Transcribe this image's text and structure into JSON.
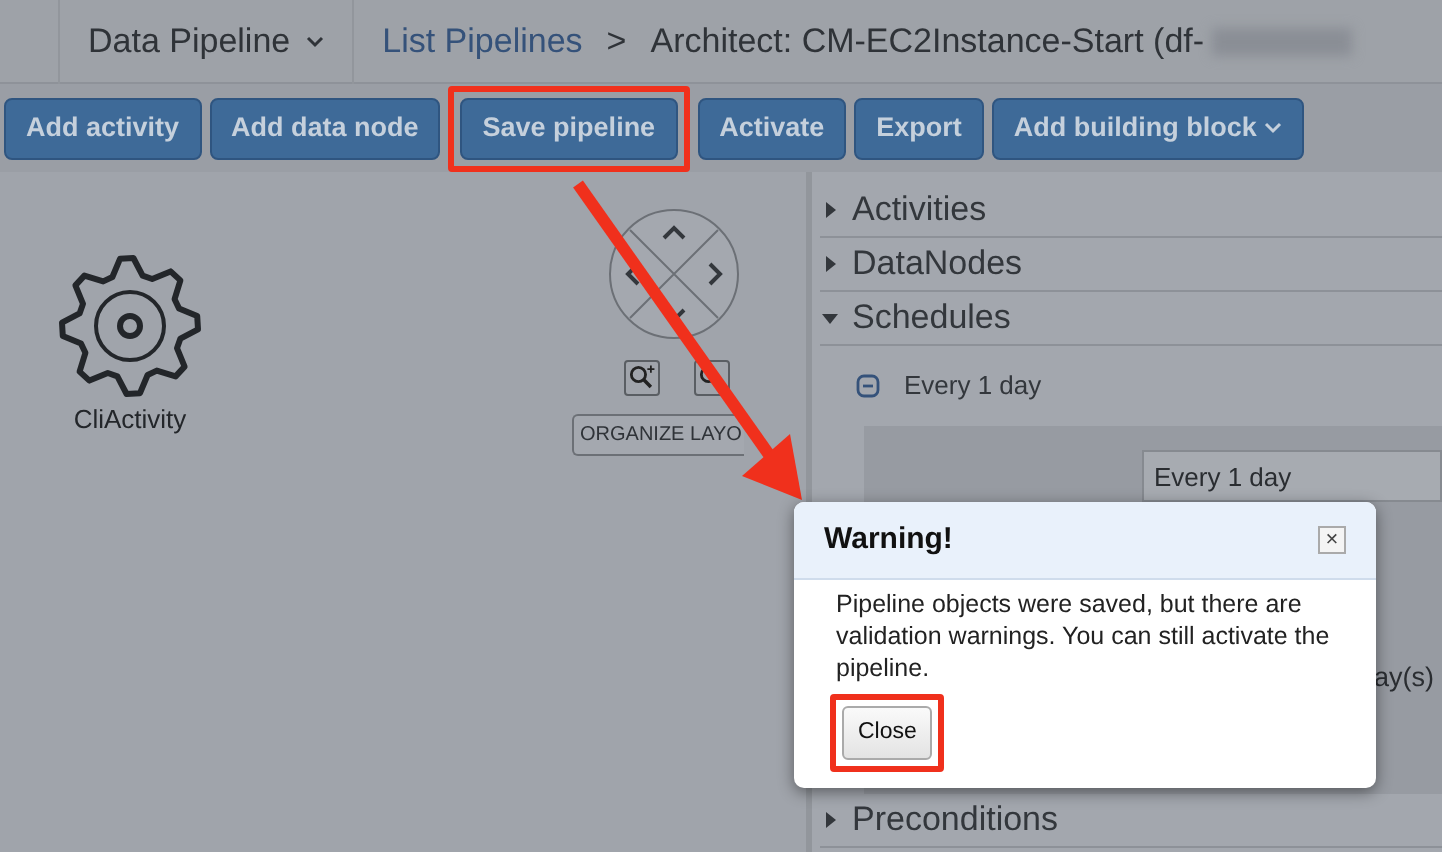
{
  "header": {
    "menu": "Data Pipeline",
    "breadcrumb_link": "List Pipelines",
    "separator": ">",
    "title": "Architect: CM-EC2Instance-Start (df-"
  },
  "toolbar": [
    {
      "label": "Add activity",
      "highlighted": false,
      "dropdown": false
    },
    {
      "label": "Add data node",
      "highlighted": false,
      "dropdown": false
    },
    {
      "label": "Save pipeline",
      "highlighted": true,
      "dropdown": false
    },
    {
      "label": "Activate",
      "highlighted": false,
      "dropdown": false
    },
    {
      "label": "Export",
      "highlighted": false,
      "dropdown": false
    },
    {
      "label": "Add building block",
      "highlighted": false,
      "dropdown": true
    }
  ],
  "canvas": {
    "node": {
      "label": "CliActivity"
    },
    "organize_button": "ORGANIZE LAYO"
  },
  "panel": {
    "sections": [
      {
        "label": "Activities",
        "expanded": false
      },
      {
        "label": "DataNodes",
        "expanded": false
      },
      {
        "label": "Schedules",
        "expanded": true,
        "children": [
          {
            "label": "Every 1 day",
            "expanded": true,
            "fields": [
              {
                "value": "Every 1 day"
              },
              {
                "value": "ay(s)"
              }
            ]
          }
        ]
      },
      {
        "label": "Preconditions",
        "expanded": false
      }
    ]
  },
  "dialog": {
    "title": "Warning!",
    "close_icon": "×",
    "message": "Pipeline objects were saved, but there are validation warnings. You can still activate the pipeline.",
    "button": {
      "label": "Close",
      "highlighted": true
    }
  }
}
